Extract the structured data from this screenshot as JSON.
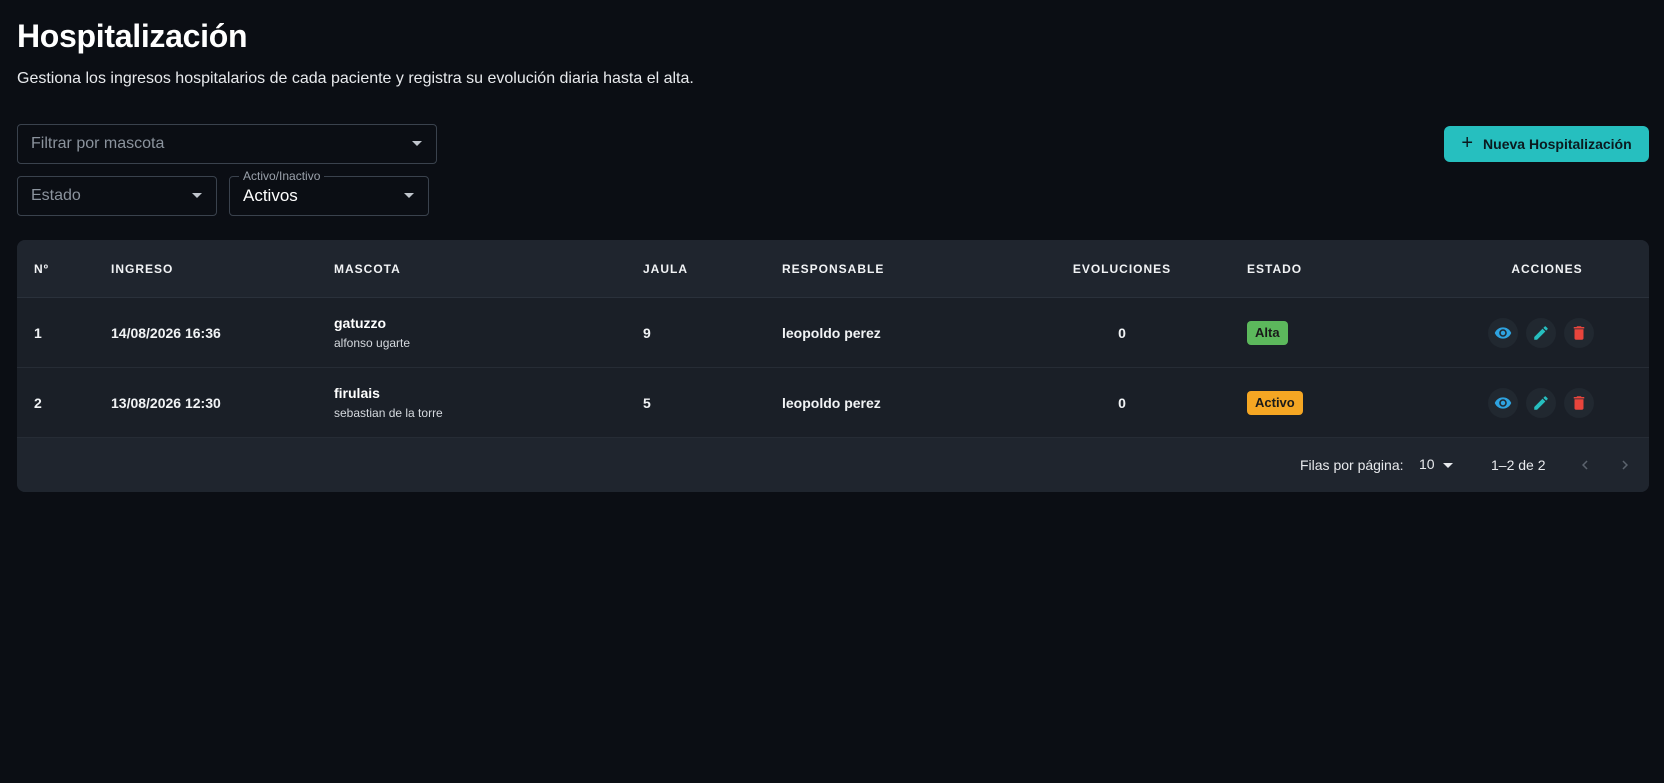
{
  "header": {
    "title": "Hospitalización",
    "subtitle": "Gestiona los ingresos hospitalarios de cada paciente y registra su evolución diaria hasta el alta."
  },
  "filters": {
    "mascota_placeholder": "Filtrar por mascota",
    "estado_placeholder": "Estado",
    "activo_label": "Activo/Inactivo",
    "activo_value": "Activos"
  },
  "toolbar": {
    "new_label": "Nueva Hospitalización",
    "new_icon": "plus-icon"
  },
  "table": {
    "columns": {
      "no": "Nº",
      "ingreso": "INGRESO",
      "mascota": "MASCOTA",
      "jaula": "JAULA",
      "responsable": "RESPONSABLE",
      "evoluciones": "EVOLUCIONES",
      "estado": "ESTADO",
      "acciones": "ACCIONES"
    },
    "rows": [
      {
        "no": "1",
        "ingreso": "14/08/2026 16:36",
        "mascota": "gatuzzo",
        "propietario": "alfonso ugarte",
        "jaula": "9",
        "responsable": "leopoldo perez",
        "evoluciones": "0",
        "estado": "Alta"
      },
      {
        "no": "2",
        "ingreso": "13/08/2026 12:30",
        "mascota": "firulais",
        "propietario": "sebastian de la torre",
        "jaula": "5",
        "responsable": "leopoldo perez",
        "evoluciones": "0",
        "estado": "Activo"
      }
    ],
    "actions": [
      "eye-icon",
      "pencil-icon",
      "trash-icon"
    ]
  },
  "pagination": {
    "rows_label": "Filas por página:",
    "rows_value": "10",
    "range": "1–2 de 2"
  },
  "colors": {
    "background": "#0b0e14",
    "accent": "#26bfbf",
    "badge_alta": "#5cb85c",
    "badge_activo": "#f5a623",
    "view_icon": "#2ea3e0",
    "edit_icon": "#26bfbf",
    "delete_icon": "#e8453c"
  }
}
